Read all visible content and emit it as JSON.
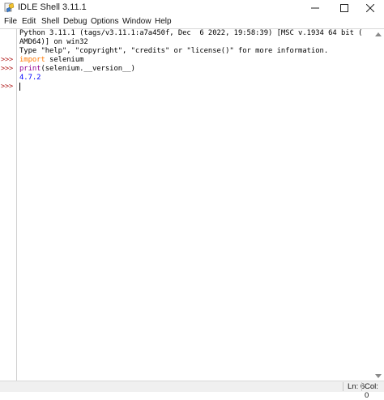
{
  "window": {
    "title": "IDLE Shell 3.11.1",
    "controls": [
      "minimize",
      "maximize",
      "close"
    ]
  },
  "menubar": {
    "items": [
      "File",
      "Edit",
      "Shell",
      "Debug",
      "Options",
      "Window",
      "Help"
    ]
  },
  "shell": {
    "lines": [
      {
        "prompt": "",
        "text": "Python 3.11.1 (tags/v3.11.1:a7a450f, Dec  6 2022, 19:58:39) [MSC v.1934 64 bit (",
        "kind": "info"
      },
      {
        "prompt": "",
        "text": "AMD64)] on win32",
        "kind": "info"
      },
      {
        "prompt": "",
        "text": "Type \"help\", \"copyright\", \"credits\" or \"license()\" for more information.",
        "kind": "info"
      },
      {
        "prompt": ">>>",
        "keyword": "import",
        "text": " selenium",
        "kind": "input"
      },
      {
        "prompt": ">>>",
        "builtin": "print",
        "text": "(selenium.__version__)",
        "kind": "input"
      },
      {
        "prompt": "",
        "text": "4.7.2",
        "kind": "output"
      },
      {
        "prompt": ">>>",
        "text": "",
        "kind": "current"
      }
    ]
  },
  "statusbar": {
    "line": "Ln: 6",
    "col": "Col: 0"
  },
  "colors": {
    "prompt": "#b22222",
    "keyword": "#ff7700",
    "builtin": "#900090",
    "output": "#0000ff"
  }
}
